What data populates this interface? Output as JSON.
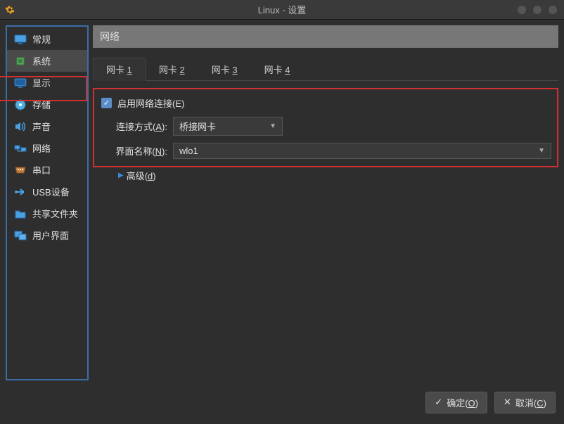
{
  "window": {
    "title": "Linux - 设置"
  },
  "sidebar": {
    "items": [
      {
        "label": "常规"
      },
      {
        "label": "系统"
      },
      {
        "label": "显示"
      },
      {
        "label": "存储"
      },
      {
        "label": "声音"
      },
      {
        "label": "网络"
      },
      {
        "label": "串口"
      },
      {
        "label": "USB设备"
      },
      {
        "label": "共享文件夹"
      },
      {
        "label": "用户界面"
      }
    ]
  },
  "page": {
    "header": "网络"
  },
  "tabs": [
    {
      "prefix": "网卡 ",
      "key": "1"
    },
    {
      "prefix": "网卡 ",
      "key": "2"
    },
    {
      "prefix": "网卡 ",
      "key": "3"
    },
    {
      "prefix": "网卡 ",
      "key": "4"
    }
  ],
  "network": {
    "enable_label_pre": "启用网络连接(",
    "enable_label_key": "E",
    "enable_label_post": ")",
    "attach_label_pre": "连接方式(",
    "attach_label_key": "A",
    "attach_label_post": "):",
    "attach_value": "桥接网卡",
    "iface_label_pre": "界面名称(",
    "iface_label_key": "N",
    "iface_label_post": "):",
    "iface_value": "wlo1",
    "advanced_pre": "高级(",
    "advanced_key": "d",
    "advanced_post": ")"
  },
  "footer": {
    "ok_pre": "确定(",
    "ok_key": "O",
    "ok_post": ")",
    "cancel_pre": "取消(",
    "cancel_key": "C",
    "cancel_post": ")"
  }
}
